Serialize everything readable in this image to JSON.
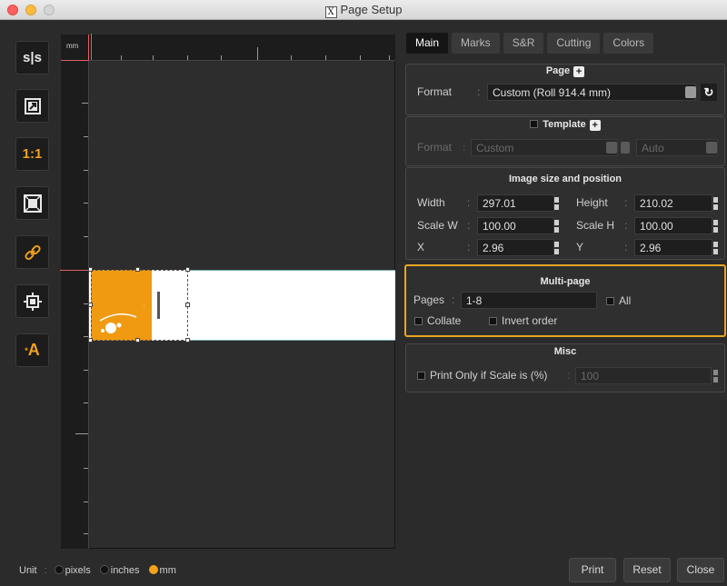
{
  "window": {
    "title": "Page Setup",
    "title_icon": "X"
  },
  "toolbar": {
    "items": [
      {
        "name": "fit-toggle-icon",
        "label": "s|s"
      },
      {
        "name": "expand-icon",
        "label": ""
      },
      {
        "name": "actual-size-icon",
        "label": "1:1"
      },
      {
        "name": "fit-page-icon",
        "label": ""
      },
      {
        "name": "link-icon",
        "label": ""
      },
      {
        "name": "center-icon",
        "label": ""
      },
      {
        "name": "text-a-icon",
        "label": "A"
      }
    ]
  },
  "ruler": {
    "unit": "mm"
  },
  "tabs": [
    "Main",
    "Marks",
    "S&R",
    "Cutting",
    "Colors"
  ],
  "page": {
    "title": "Page",
    "format_label": "Format",
    "format_value": "Custom (Roll 914.4 mm)"
  },
  "template": {
    "title": "Template",
    "format_label": "Format",
    "format_value": "Custom",
    "auto_value": "Auto"
  },
  "image_size": {
    "title": "Image size and position",
    "width_label": "Width",
    "width_value": "297.01",
    "height_label": "Height",
    "height_value": "210.02",
    "scalew_label": "Scale W",
    "scalew_value": "100.00",
    "scaleh_label": "Scale H",
    "scaleh_value": "100.00",
    "x_label": "X",
    "x_value": "2.96",
    "y_label": "Y",
    "y_value": "2.96"
  },
  "multipage": {
    "title": "Multi-page",
    "pages_label": "Pages",
    "pages_value": "1-8",
    "all_label": "All",
    "collate_label": "Collate",
    "invert_label": "Invert order"
  },
  "misc": {
    "title": "Misc",
    "print_only_label": "Print Only if Scale is (%)",
    "print_only_value": "100"
  },
  "units": {
    "label": "Unit",
    "options": [
      "pixels",
      "inches",
      "mm"
    ],
    "selected": "mm"
  },
  "buttons": {
    "print": "Print",
    "reset": "Reset",
    "close": "Close"
  },
  "colors": {
    "accent": "#f09a12",
    "highlight_border": "#e8a524"
  }
}
